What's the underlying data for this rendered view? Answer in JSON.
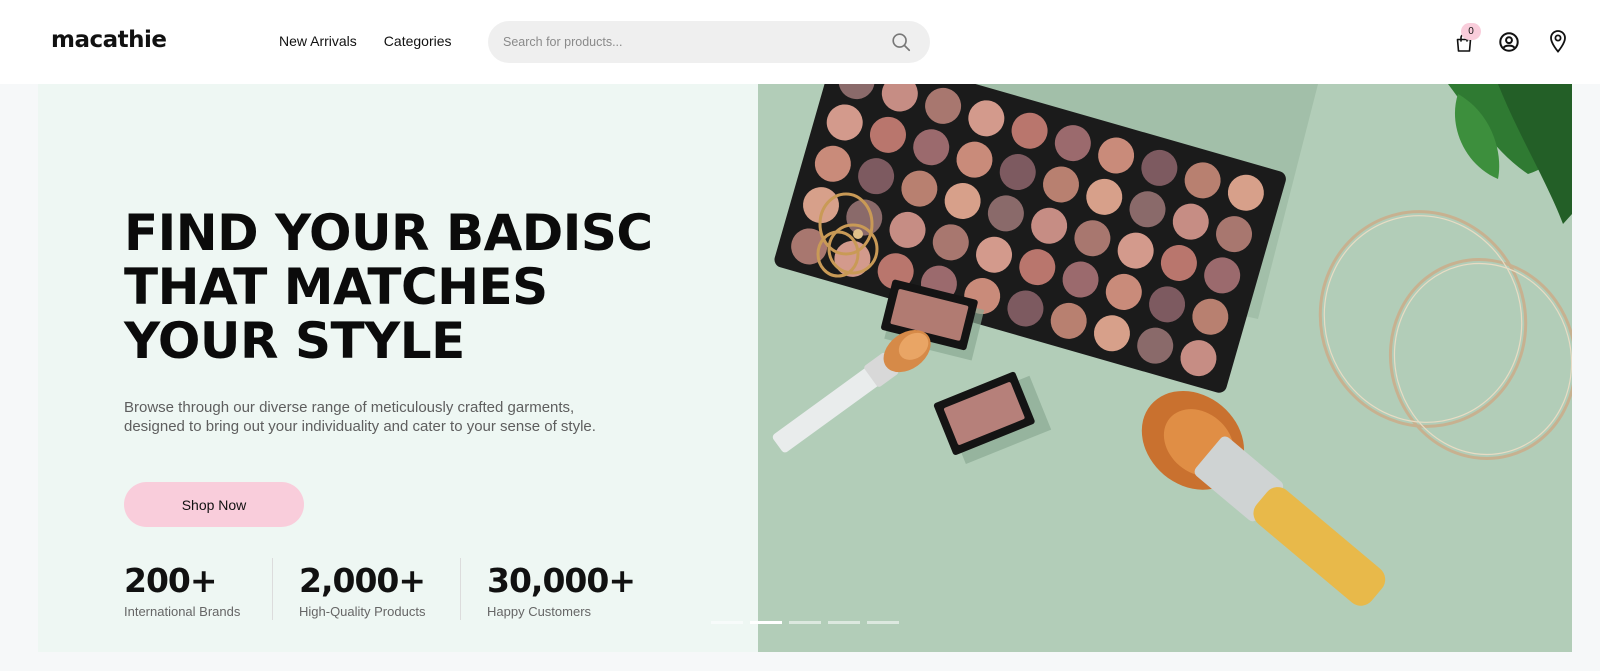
{
  "header": {
    "logo": "macathie",
    "nav": [
      "New Arrivals",
      "Categories"
    ],
    "search_placeholder": "Search for products...",
    "cart_count": "0",
    "icons": [
      "search-icon",
      "cart-icon",
      "user-icon",
      "location-pin-icon"
    ]
  },
  "hero": {
    "headline": [
      "FIND YOUR BADISC",
      "THAT MATCHES",
      "YOUR STYLE"
    ],
    "description": "Browse through our diverse range of meticulously crafted garments, designed to bring out your individuality and cater to your sense of style.",
    "cta": "Shop Now",
    "stats": [
      {
        "value": "200+",
        "label": "International Brands"
      },
      {
        "value": "2,000+",
        "label": "High-Quality Products"
      },
      {
        "value": "30,000+",
        "label": "Happy Customers"
      }
    ],
    "slides_total": 5,
    "active_slide": 2
  },
  "colors": {
    "accent_pink": "#f9cddb",
    "hero_bg": "#eef7f3",
    "image_bg": "#b2cdb8"
  }
}
